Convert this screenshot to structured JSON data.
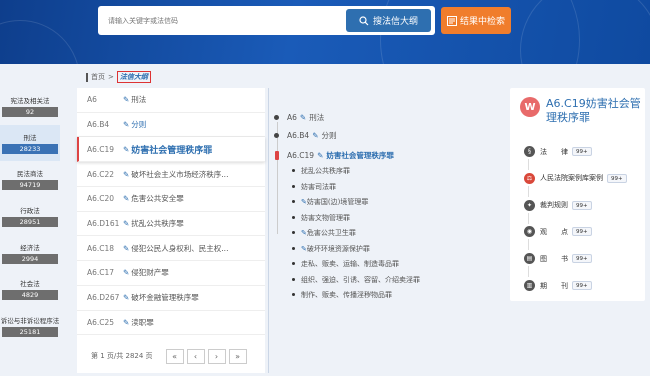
{
  "search": {
    "placeholder": "请输入关键字或法信码",
    "button_label": "搜法信大纲",
    "result_button_label": "结果中检索"
  },
  "breadcrumb": {
    "home": "首页",
    "separator": ">",
    "current": "法信大纲"
  },
  "left_nav": [
    {
      "label": "宪法及相关法",
      "count": "92"
    },
    {
      "label": "刑法",
      "count": "28233",
      "active": true
    },
    {
      "label": "民法商法",
      "count": "94719"
    },
    {
      "label": "行政法",
      "count": "28951"
    },
    {
      "label": "经济法",
      "count": "2994"
    },
    {
      "label": "社会法",
      "count": "4829"
    },
    {
      "label": "诉讼与非诉讼程序法",
      "count": "25181"
    }
  ],
  "list": [
    {
      "code": "A6",
      "text": "刑法",
      "style": "gray"
    },
    {
      "code": "A6.B4",
      "text": "分则",
      "style": "blue"
    },
    {
      "code": "A6.C19",
      "text": "妨害社会管理秩序罪",
      "style": "active"
    },
    {
      "code": "A6.C22",
      "text": "破坏社会主义市场经济秩序...",
      "style": "gray"
    },
    {
      "code": "A6.C20",
      "text": "危害公共安全罪",
      "style": "gray"
    },
    {
      "code": "A6.D161",
      "text": "扰乱公共秩序罪",
      "style": "gray"
    },
    {
      "code": "A6.C18",
      "text": "侵犯公民人身权利、民主权...",
      "style": "gray"
    },
    {
      "code": "A6.C17",
      "text": "侵犯财产罪",
      "style": "gray"
    },
    {
      "code": "A6.D267",
      "text": "破坏金融管理秩序罪",
      "style": "gray"
    },
    {
      "code": "A6.C25",
      "text": "渎职罪",
      "style": "gray"
    }
  ],
  "pager": {
    "info": "第 1 页/共 2824 页",
    "first": "«",
    "prev": "‹",
    "next": "›",
    "last": "»"
  },
  "tree": {
    "nodes": [
      {
        "code": "A6",
        "text": "刑法"
      },
      {
        "code": "A6.B4",
        "text": "分则"
      },
      {
        "code": "A6.C19",
        "text": "妨害社会管理秩序罪"
      }
    ],
    "children": [
      "扰乱公共秩序罪",
      "妨害司法罪",
      "妨害国(边)境管理罪",
      "妨害文物管理罪",
      "危害公共卫生罪",
      "破坏环境资源保护罪",
      "走私、贩卖、运输、制造毒品罪",
      "组织、强迫、引诱、容留、介绍卖淫罪",
      "制作、贩卖、传播淫秽物品罪"
    ]
  },
  "card": {
    "logo": "W",
    "title": "A6.C19妨害社会管理秩序罪",
    "rows": [
      {
        "label": "法　　律",
        "badge": "99+",
        "icon": "law-icon",
        "color": "#555555"
      },
      {
        "label": "人民法院案例库案例",
        "badge": "99+",
        "icon": "court-icon",
        "color": "#d9483a"
      },
      {
        "label": "裁判规则",
        "badge": "99+",
        "icon": "rule-icon",
        "color": "#555555"
      },
      {
        "label": "观　　点",
        "badge": "99+",
        "icon": "view-icon",
        "color": "#555555"
      },
      {
        "label": "图　　书",
        "badge": "99+",
        "icon": "book-icon",
        "color": "#555555"
      },
      {
        "label": "期　　刊",
        "badge": "99+",
        "icon": "journal-icon",
        "color": "#555555"
      }
    ]
  }
}
